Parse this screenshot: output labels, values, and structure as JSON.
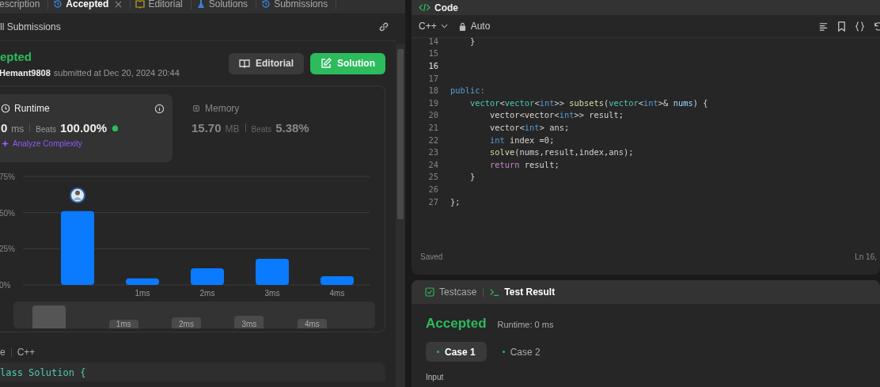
{
  "left_tabs": [
    {
      "label": "escription",
      "selected": false,
      "closable": false
    },
    {
      "label": "Accepted",
      "selected": true,
      "closable": true
    },
    {
      "label": "Editorial",
      "selected": false,
      "closable": false
    },
    {
      "label": "Solutions",
      "selected": false,
      "closable": false
    },
    {
      "label": "Submissions",
      "selected": false,
      "closable": false
    }
  ],
  "submissions_link": "ll Submissions",
  "result": {
    "status": "epted",
    "user": "Hemant9808",
    "submitted": "submitted at Dec 20, 2024 20:44"
  },
  "buttons": [
    {
      "label": "Editorial",
      "kind": "secondary"
    },
    {
      "label": "Solution",
      "kind": "primary"
    }
  ],
  "runtime": {
    "title": "Runtime",
    "value": "0",
    "unit": "ms",
    "beats_label": "Beats",
    "beats": "100.00%",
    "analyze": "Analyze Complexity"
  },
  "memory": {
    "title": "Memory",
    "value": "15.70",
    "unit": "MB",
    "beats_label": "Beats",
    "beats": "5.38%"
  },
  "chart_data": {
    "type": "bar",
    "categories": [
      null,
      "1ms",
      "2ms",
      "3ms",
      "4ms"
    ],
    "values": [
      51,
      4.5,
      11.5,
      18,
      6
    ],
    "ylim": [
      0,
      75
    ],
    "yticks": [
      {
        "value": 0,
        "label": "0%"
      },
      {
        "value": 25,
        "label": "25%"
      },
      {
        "value": 50,
        "label": "50%"
      },
      {
        "value": 75,
        "label": "75%"
      }
    ]
  },
  "range_labels": [
    "1ms",
    "2ms",
    "3ms",
    "4ms"
  ],
  "language_bar": {
    "prefix": "e",
    "language": "C++"
  },
  "code_preview": "lass Solution {",
  "code_panel": {
    "title": "Code",
    "language": "C++",
    "mode": "Auto",
    "status": "Saved",
    "position": "Ln 16,",
    "lines": [
      {
        "number": "14",
        "active": false,
        "tokens": [
          {
            "kind": "plain",
            "text": "    }"
          }
        ]
      },
      {
        "number": "15",
        "active": false
      },
      {
        "number": "16",
        "active": true
      },
      {
        "number": "17",
        "active": false
      },
      {
        "number": "18",
        "active": false,
        "tokens": [
          {
            "kind": "keyword",
            "text": "public:"
          }
        ]
      },
      {
        "number": "19",
        "active": false,
        "tokens": [
          {
            "kind": "type",
            "text": "    vector"
          },
          {
            "kind": "plain",
            "text": "<"
          },
          {
            "kind": "type",
            "text": "vector"
          },
          {
            "kind": "plain",
            "text": "<"
          },
          {
            "kind": "keyword",
            "text": "int"
          },
          {
            "kind": "plain",
            "text": ">> "
          },
          {
            "kind": "function",
            "text": "subsets"
          },
          {
            "kind": "plain",
            "text": "("
          },
          {
            "kind": "type",
            "text": "vector"
          },
          {
            "kind": "plain",
            "text": "<"
          },
          {
            "kind": "keyword",
            "text": "int"
          },
          {
            "kind": "plain",
            "text": ">& "
          },
          {
            "kind": "param",
            "text": "nums"
          },
          {
            "kind": "plain",
            "text": ") {"
          }
        ]
      },
      {
        "number": "20",
        "active": false,
        "tokens": [
          {
            "kind": "plain",
            "text": "        vector<vector<"
          },
          {
            "kind": "keyword",
            "text": "int"
          },
          {
            "kind": "plain",
            "text": ">> result;"
          }
        ]
      },
      {
        "number": "21",
        "active": false,
        "tokens": [
          {
            "kind": "plain",
            "text": "        vector<"
          },
          {
            "kind": "keyword",
            "text": "int"
          },
          {
            "kind": "plain",
            "text": "> ans;"
          }
        ]
      },
      {
        "number": "22",
        "active": false,
        "tokens": [
          {
            "kind": "keyword",
            "text": "        int"
          },
          {
            "kind": "plain",
            "text": " index =0;"
          }
        ]
      },
      {
        "number": "23",
        "active": false,
        "tokens": [
          {
            "kind": "function",
            "text": "        solve"
          },
          {
            "kind": "plain",
            "text": "(nums,result,index,ans);"
          }
        ]
      },
      {
        "number": "24",
        "active": false,
        "tokens": [
          {
            "kind": "control",
            "text": "        return"
          },
          {
            "kind": "plain",
            "text": " result;"
          }
        ]
      },
      {
        "number": "25",
        "active": false,
        "tokens": [
          {
            "kind": "plain",
            "text": "    }"
          }
        ]
      },
      {
        "number": "26",
        "active": false
      },
      {
        "number": "27",
        "active": false,
        "tokens": [
          {
            "kind": "plain",
            "text": "};"
          }
        ]
      }
    ]
  },
  "test_tabs": [
    {
      "label": "Testcase",
      "selected": false
    },
    {
      "label": "Test Result",
      "selected": true
    }
  ],
  "test_result": {
    "status": "Accepted",
    "runtime": "Runtime: 0 ms",
    "cases": [
      {
        "label": "Case 1",
        "selected": true
      },
      {
        "label": "Case 2",
        "selected": false
      }
    ],
    "input_label": "Input"
  }
}
